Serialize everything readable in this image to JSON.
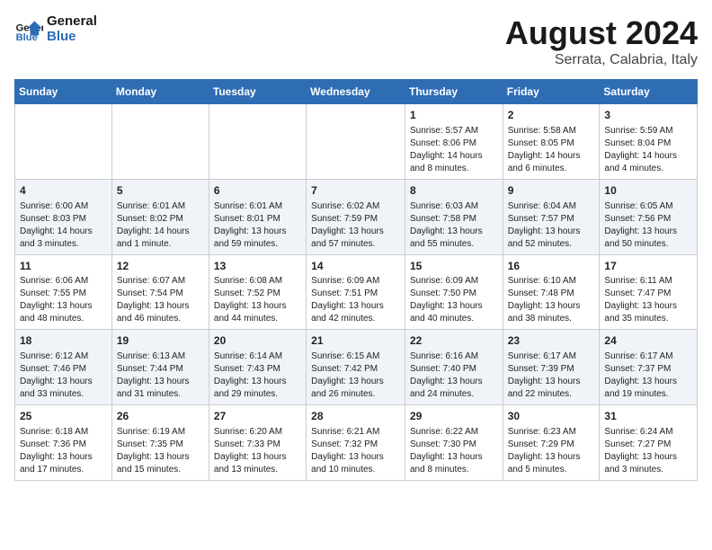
{
  "logo": {
    "line1": "General",
    "line2": "Blue"
  },
  "title": "August 2024",
  "subtitle": "Serrata, Calabria, Italy",
  "weekdays": [
    "Sunday",
    "Monday",
    "Tuesday",
    "Wednesday",
    "Thursday",
    "Friday",
    "Saturday"
  ],
  "weeks": [
    [
      {
        "day": "",
        "info": ""
      },
      {
        "day": "",
        "info": ""
      },
      {
        "day": "",
        "info": ""
      },
      {
        "day": "",
        "info": ""
      },
      {
        "day": "1",
        "info": "Sunrise: 5:57 AM\nSunset: 8:06 PM\nDaylight: 14 hours\nand 8 minutes."
      },
      {
        "day": "2",
        "info": "Sunrise: 5:58 AM\nSunset: 8:05 PM\nDaylight: 14 hours\nand 6 minutes."
      },
      {
        "day": "3",
        "info": "Sunrise: 5:59 AM\nSunset: 8:04 PM\nDaylight: 14 hours\nand 4 minutes."
      }
    ],
    [
      {
        "day": "4",
        "info": "Sunrise: 6:00 AM\nSunset: 8:03 PM\nDaylight: 14 hours\nand 3 minutes."
      },
      {
        "day": "5",
        "info": "Sunrise: 6:01 AM\nSunset: 8:02 PM\nDaylight: 14 hours\nand 1 minute."
      },
      {
        "day": "6",
        "info": "Sunrise: 6:01 AM\nSunset: 8:01 PM\nDaylight: 13 hours\nand 59 minutes."
      },
      {
        "day": "7",
        "info": "Sunrise: 6:02 AM\nSunset: 7:59 PM\nDaylight: 13 hours\nand 57 minutes."
      },
      {
        "day": "8",
        "info": "Sunrise: 6:03 AM\nSunset: 7:58 PM\nDaylight: 13 hours\nand 55 minutes."
      },
      {
        "day": "9",
        "info": "Sunrise: 6:04 AM\nSunset: 7:57 PM\nDaylight: 13 hours\nand 52 minutes."
      },
      {
        "day": "10",
        "info": "Sunrise: 6:05 AM\nSunset: 7:56 PM\nDaylight: 13 hours\nand 50 minutes."
      }
    ],
    [
      {
        "day": "11",
        "info": "Sunrise: 6:06 AM\nSunset: 7:55 PM\nDaylight: 13 hours\nand 48 minutes."
      },
      {
        "day": "12",
        "info": "Sunrise: 6:07 AM\nSunset: 7:54 PM\nDaylight: 13 hours\nand 46 minutes."
      },
      {
        "day": "13",
        "info": "Sunrise: 6:08 AM\nSunset: 7:52 PM\nDaylight: 13 hours\nand 44 minutes."
      },
      {
        "day": "14",
        "info": "Sunrise: 6:09 AM\nSunset: 7:51 PM\nDaylight: 13 hours\nand 42 minutes."
      },
      {
        "day": "15",
        "info": "Sunrise: 6:09 AM\nSunset: 7:50 PM\nDaylight: 13 hours\nand 40 minutes."
      },
      {
        "day": "16",
        "info": "Sunrise: 6:10 AM\nSunset: 7:48 PM\nDaylight: 13 hours\nand 38 minutes."
      },
      {
        "day": "17",
        "info": "Sunrise: 6:11 AM\nSunset: 7:47 PM\nDaylight: 13 hours\nand 35 minutes."
      }
    ],
    [
      {
        "day": "18",
        "info": "Sunrise: 6:12 AM\nSunset: 7:46 PM\nDaylight: 13 hours\nand 33 minutes."
      },
      {
        "day": "19",
        "info": "Sunrise: 6:13 AM\nSunset: 7:44 PM\nDaylight: 13 hours\nand 31 minutes."
      },
      {
        "day": "20",
        "info": "Sunrise: 6:14 AM\nSunset: 7:43 PM\nDaylight: 13 hours\nand 29 minutes."
      },
      {
        "day": "21",
        "info": "Sunrise: 6:15 AM\nSunset: 7:42 PM\nDaylight: 13 hours\nand 26 minutes."
      },
      {
        "day": "22",
        "info": "Sunrise: 6:16 AM\nSunset: 7:40 PM\nDaylight: 13 hours\nand 24 minutes."
      },
      {
        "day": "23",
        "info": "Sunrise: 6:17 AM\nSunset: 7:39 PM\nDaylight: 13 hours\nand 22 minutes."
      },
      {
        "day": "24",
        "info": "Sunrise: 6:17 AM\nSunset: 7:37 PM\nDaylight: 13 hours\nand 19 minutes."
      }
    ],
    [
      {
        "day": "25",
        "info": "Sunrise: 6:18 AM\nSunset: 7:36 PM\nDaylight: 13 hours\nand 17 minutes."
      },
      {
        "day": "26",
        "info": "Sunrise: 6:19 AM\nSunset: 7:35 PM\nDaylight: 13 hours\nand 15 minutes."
      },
      {
        "day": "27",
        "info": "Sunrise: 6:20 AM\nSunset: 7:33 PM\nDaylight: 13 hours\nand 13 minutes."
      },
      {
        "day": "28",
        "info": "Sunrise: 6:21 AM\nSunset: 7:32 PM\nDaylight: 13 hours\nand 10 minutes."
      },
      {
        "day": "29",
        "info": "Sunrise: 6:22 AM\nSunset: 7:30 PM\nDaylight: 13 hours\nand 8 minutes."
      },
      {
        "day": "30",
        "info": "Sunrise: 6:23 AM\nSunset: 7:29 PM\nDaylight: 13 hours\nand 5 minutes."
      },
      {
        "day": "31",
        "info": "Sunrise: 6:24 AM\nSunset: 7:27 PM\nDaylight: 13 hours\nand 3 minutes."
      }
    ]
  ]
}
